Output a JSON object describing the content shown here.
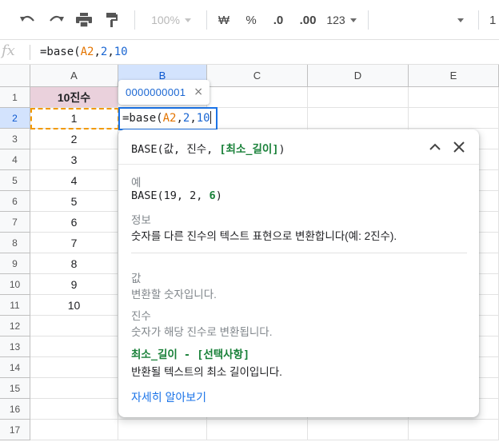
{
  "toolbar": {
    "zoom": "100%",
    "currency_label": "₩",
    "percent_label": "%",
    "decrease_decimal_label": ".0",
    "increase_decimal_label": ".00",
    "more_formats_label": "123",
    "font_size_partial": "1"
  },
  "formula_bar": {
    "fx_label": "fx",
    "prefix": "=base(",
    "ref": "A2",
    "sep1": ",",
    "arg2": "2",
    "sep2": ",",
    "arg3": "10"
  },
  "columns": [
    "A",
    "B",
    "C",
    "D",
    "E"
  ],
  "rows": [
    "1",
    "2",
    "3",
    "4",
    "5",
    "6",
    "7",
    "8",
    "9",
    "10",
    "11",
    "12",
    "13",
    "14",
    "15",
    "16",
    "17"
  ],
  "column_a": {
    "header": "10진수",
    "values": [
      "1",
      "2",
      "3",
      "4",
      "5",
      "6",
      "7",
      "8",
      "9",
      "10"
    ]
  },
  "preview": {
    "value": "0000000001",
    "close": "×"
  },
  "help": {
    "title_func": "BASE(값, 진수, ",
    "title_opt": "[최소_길이]",
    "title_end": ")",
    "example_label": "예",
    "example_prefix": "BASE(19, 2, ",
    "example_hi": "6",
    "example_end": ")",
    "info_label": "정보",
    "info_text": "숫자를 다른 진수의 텍스트 표현으로 변환합니다(예: 2진수).",
    "arg1_name": "값",
    "arg1_desc": "변환할 숫자입니다.",
    "arg2_name": "진수",
    "arg2_desc": "숫자가 해당 진수로 변환됩니다.",
    "arg3_name": "최소_길이 - [선택사항]",
    "arg3_desc": "반환될 텍스트의 최소 길이입니다.",
    "learn_more": "자세히 알아보기"
  }
}
